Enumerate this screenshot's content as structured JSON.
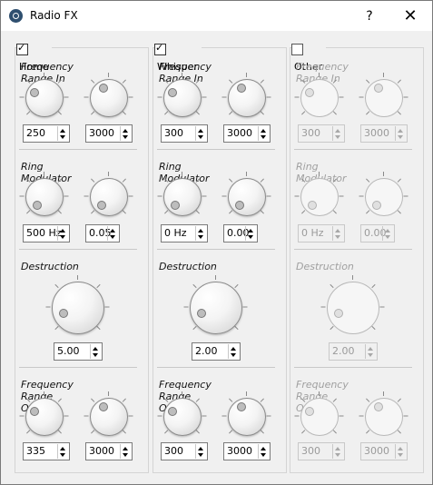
{
  "window": {
    "title": "Radio FX",
    "help_label": "?",
    "close_label": "✕"
  },
  "columns": [
    {
      "name": "Home",
      "checked": true,
      "enabled": true,
      "freq_in": {
        "title": "Frequency Range In",
        "low": "250",
        "high": "3000"
      },
      "ring_mod": {
        "title": "Ring Modulator",
        "freq": "500 Hz",
        "mix": "0.05"
      },
      "destruction": {
        "title": "Destruction",
        "value": "5.00"
      },
      "freq_out": {
        "title": "Frequency Range Out",
        "low": "335",
        "high": "3000"
      }
    },
    {
      "name": "Whisper",
      "checked": true,
      "enabled": true,
      "freq_in": {
        "title": "Frequency Range In",
        "low": "300",
        "high": "3000"
      },
      "ring_mod": {
        "title": "Ring Modulator",
        "freq": "0 Hz",
        "mix": "0.00"
      },
      "destruction": {
        "title": "Destruction",
        "value": "2.00"
      },
      "freq_out": {
        "title": "Frequency Range Out",
        "low": "300",
        "high": "3000"
      }
    },
    {
      "name": "Other",
      "checked": false,
      "enabled": false,
      "freq_in": {
        "title": "Frequency Range In",
        "low": "300",
        "high": "3000"
      },
      "ring_mod": {
        "title": "Ring Modulator",
        "freq": "0 Hz",
        "mix": "0.00"
      },
      "destruction": {
        "title": "Destruction",
        "value": "2.00"
      },
      "freq_out": {
        "title": "Frequency Range Out",
        "low": "300",
        "high": "3000"
      }
    }
  ]
}
